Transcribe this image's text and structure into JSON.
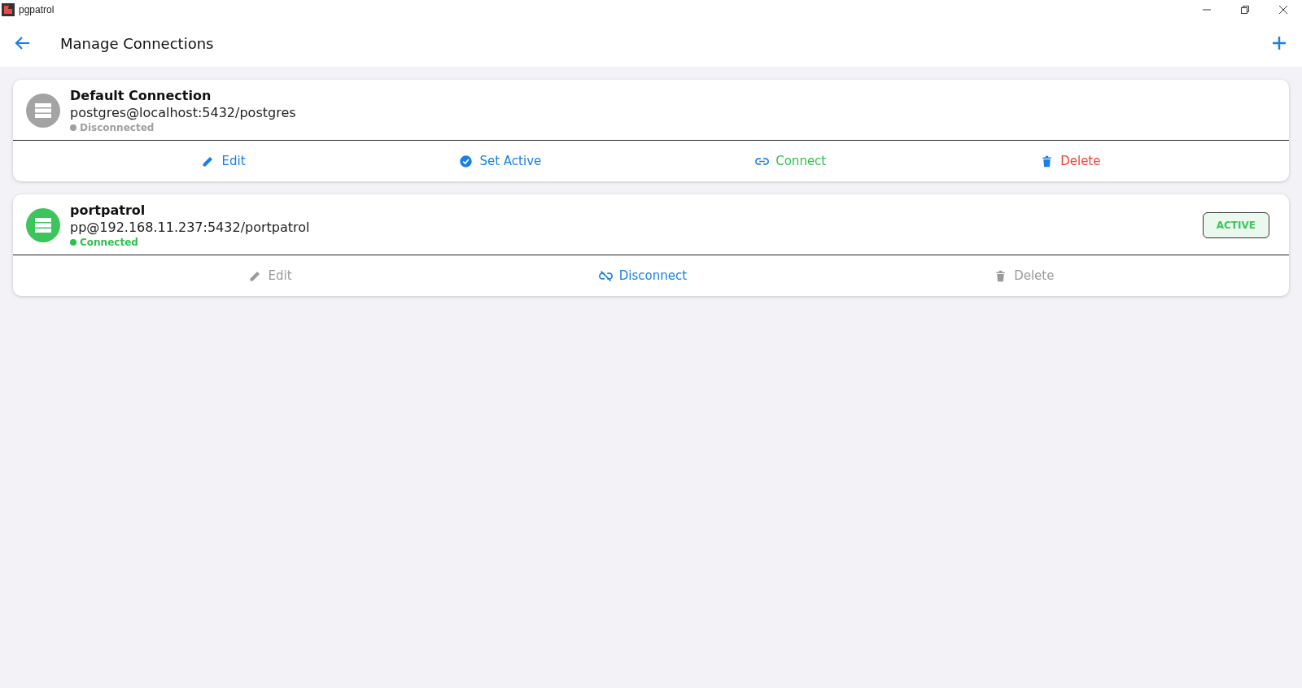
{
  "window": {
    "title": "pgpatrol"
  },
  "header": {
    "title": "Manage Connections"
  },
  "connections": [
    {
      "name": "Default Connection",
      "address": "postgres@localhost:5432/postgres",
      "connected": false,
      "status": "Disconnected",
      "active": false,
      "actions": [
        {
          "kind": "edit",
          "label": "Edit",
          "disabled": false
        },
        {
          "kind": "set_active",
          "label": "Set Active",
          "disabled": false
        },
        {
          "kind": "connect",
          "label": "Connect",
          "disabled": false
        },
        {
          "kind": "delete",
          "label": "Delete",
          "disabled": false
        }
      ]
    },
    {
      "name": "portpatrol",
      "address": "pp@192.168.11.237:5432/portpatrol",
      "connected": true,
      "status": "Connected",
      "active": true,
      "badge": "ACTIVE",
      "actions": [
        {
          "kind": "edit",
          "label": "Edit",
          "disabled": true
        },
        {
          "kind": "disconnect",
          "label": "Disconnect",
          "disabled": false
        },
        {
          "kind": "delete",
          "label": "Delete",
          "disabled": true
        }
      ]
    }
  ]
}
